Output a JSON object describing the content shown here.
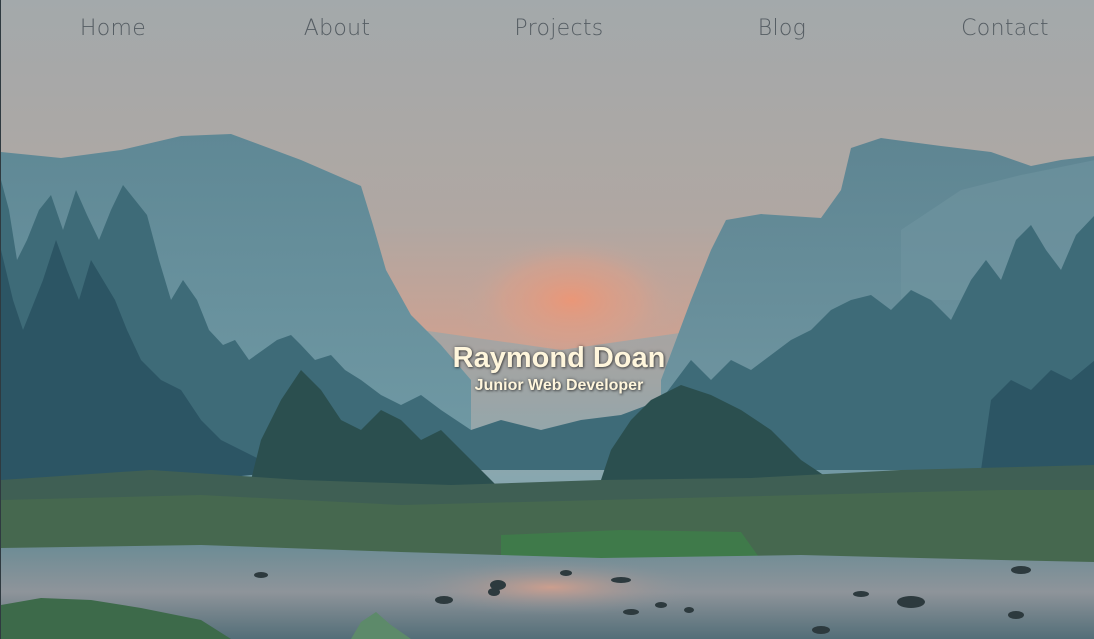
{
  "nav": {
    "items": [
      {
        "label": "Home"
      },
      {
        "label": "About"
      },
      {
        "label": "Projects"
      },
      {
        "label": "Blog"
      },
      {
        "label": "Contact"
      }
    ]
  },
  "hero": {
    "name": "Raymond Doan",
    "role": "Junior Web Developer",
    "background_image": "mountain-valley-sunset-river"
  },
  "colors": {
    "nav_text": "#555d63",
    "hero_text": "#fff6dc",
    "sky_top": "#9aa6aa",
    "sky_glow": "#e39f84"
  }
}
